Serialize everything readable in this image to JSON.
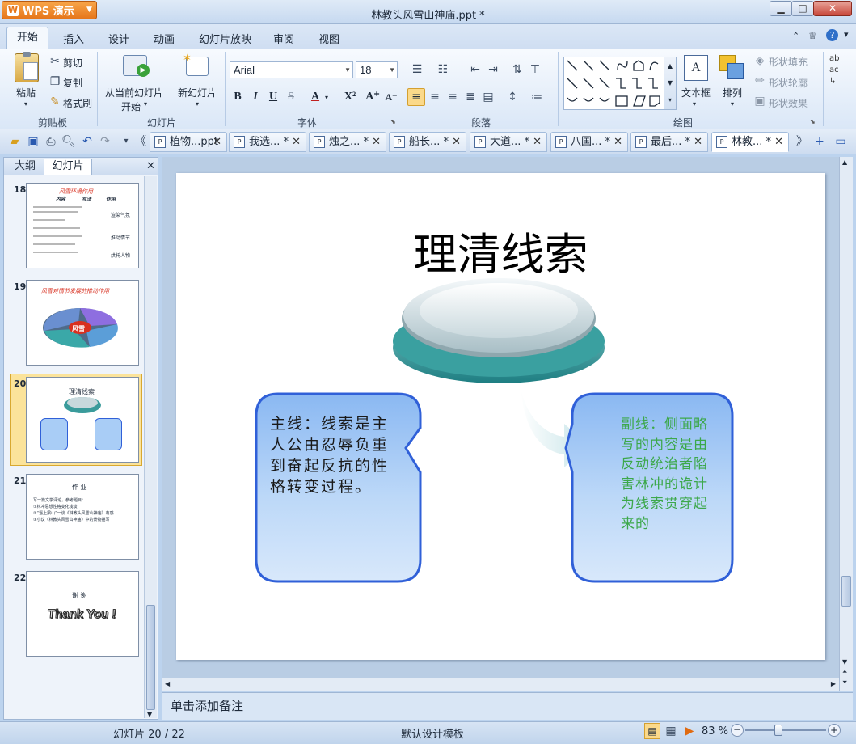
{
  "app": {
    "name": "WPS 演示",
    "document_title": "林教头风雪山神庙.ppt *"
  },
  "window_controls": {
    "minimize": "▁",
    "maximize": "□",
    "close": "✕"
  },
  "ribbon_tabs": [
    "开始",
    "插入",
    "设计",
    "动画",
    "幻灯片放映",
    "审阅",
    "视图"
  ],
  "ribbon": {
    "clipboard": {
      "paste": "粘贴",
      "cut": "剪切",
      "copy": "复制",
      "format_painter": "格式刷",
      "group": "剪贴板"
    },
    "slides": {
      "from_current": "从当前幻灯片",
      "start": "开始",
      "new_slide": "新幻灯片",
      "group": "幻灯片"
    },
    "font": {
      "name": "Arial",
      "size": "18",
      "bold": "B",
      "italic": "I",
      "underline": "U",
      "strike": "S",
      "font_color": "A",
      "superscript": "X²",
      "grow": "A⁺",
      "shrink": "A⁻",
      "group": "字体"
    },
    "paragraph": {
      "group": "段落"
    },
    "drawing": {
      "textbox": "文本框",
      "arrange": "排列",
      "shape_fill": "形状填充",
      "shape_outline": "形状轮廓",
      "shape_effect": "形状效果",
      "group": "绘图"
    }
  },
  "doc_tabs": [
    {
      "label": "植物...ppt",
      "close": "✕"
    },
    {
      "label": "我选... *",
      "close": "✕"
    },
    {
      "label": "烛之... *",
      "close": "✕"
    },
    {
      "label": "船长... *",
      "close": "✕"
    },
    {
      "label": "大道... *",
      "close": "✕"
    },
    {
      "label": "八国... *",
      "close": "✕"
    },
    {
      "label": "最后... *",
      "close": "✕"
    },
    {
      "label": "林教... *",
      "close": "✕"
    }
  ],
  "left_panel": {
    "tab_outline": "大纲",
    "tab_slides": "幻灯片",
    "close": "✕"
  },
  "thumbnails": [
    {
      "number": "18",
      "title": "风雪环境作用",
      "cols": [
        "内容",
        "写法",
        "作用"
      ],
      "side": [
        "渲染气氛",
        "推动情节",
        "烘托人物"
      ]
    },
    {
      "number": "19",
      "title": "风雪对情节发展的推动作用",
      "center": "风雪"
    },
    {
      "number": "20",
      "title": "理清线索"
    },
    {
      "number": "21",
      "title": "作 业",
      "lines": [
        "写一篇文学评论，参考题目：",
        "①林冲思想性格变化浅谈",
        "②“逼上梁山”一谈《林教头风雪山神庙》有感",
        "③小议《林教头风雪山神庙》中的景物描写"
      ]
    },
    {
      "number": "22",
      "title": "谢 谢",
      "thanks": "Thank You !"
    }
  ],
  "slide": {
    "title": "理清线索",
    "main_line": "主线：线索是主人公由忍辱负重到奋起反抗的性格转变过程。",
    "sub_line": "副线：侧面略写的内容是由反动统治者陷害林冲的诡计为线索贯穿起来的"
  },
  "notes_placeholder": "单击添加备注",
  "status": {
    "slide_counter": "幻灯片 20 / 22",
    "template": "默认设计模板",
    "zoom": "83 %"
  },
  "colors": {
    "accent_orange": "#e6761a",
    "bubble_fill": "#a9cdf6",
    "bubble_border": "#3060d8",
    "sub_text": "#3ca84a",
    "disc": "#3a9b9b"
  }
}
